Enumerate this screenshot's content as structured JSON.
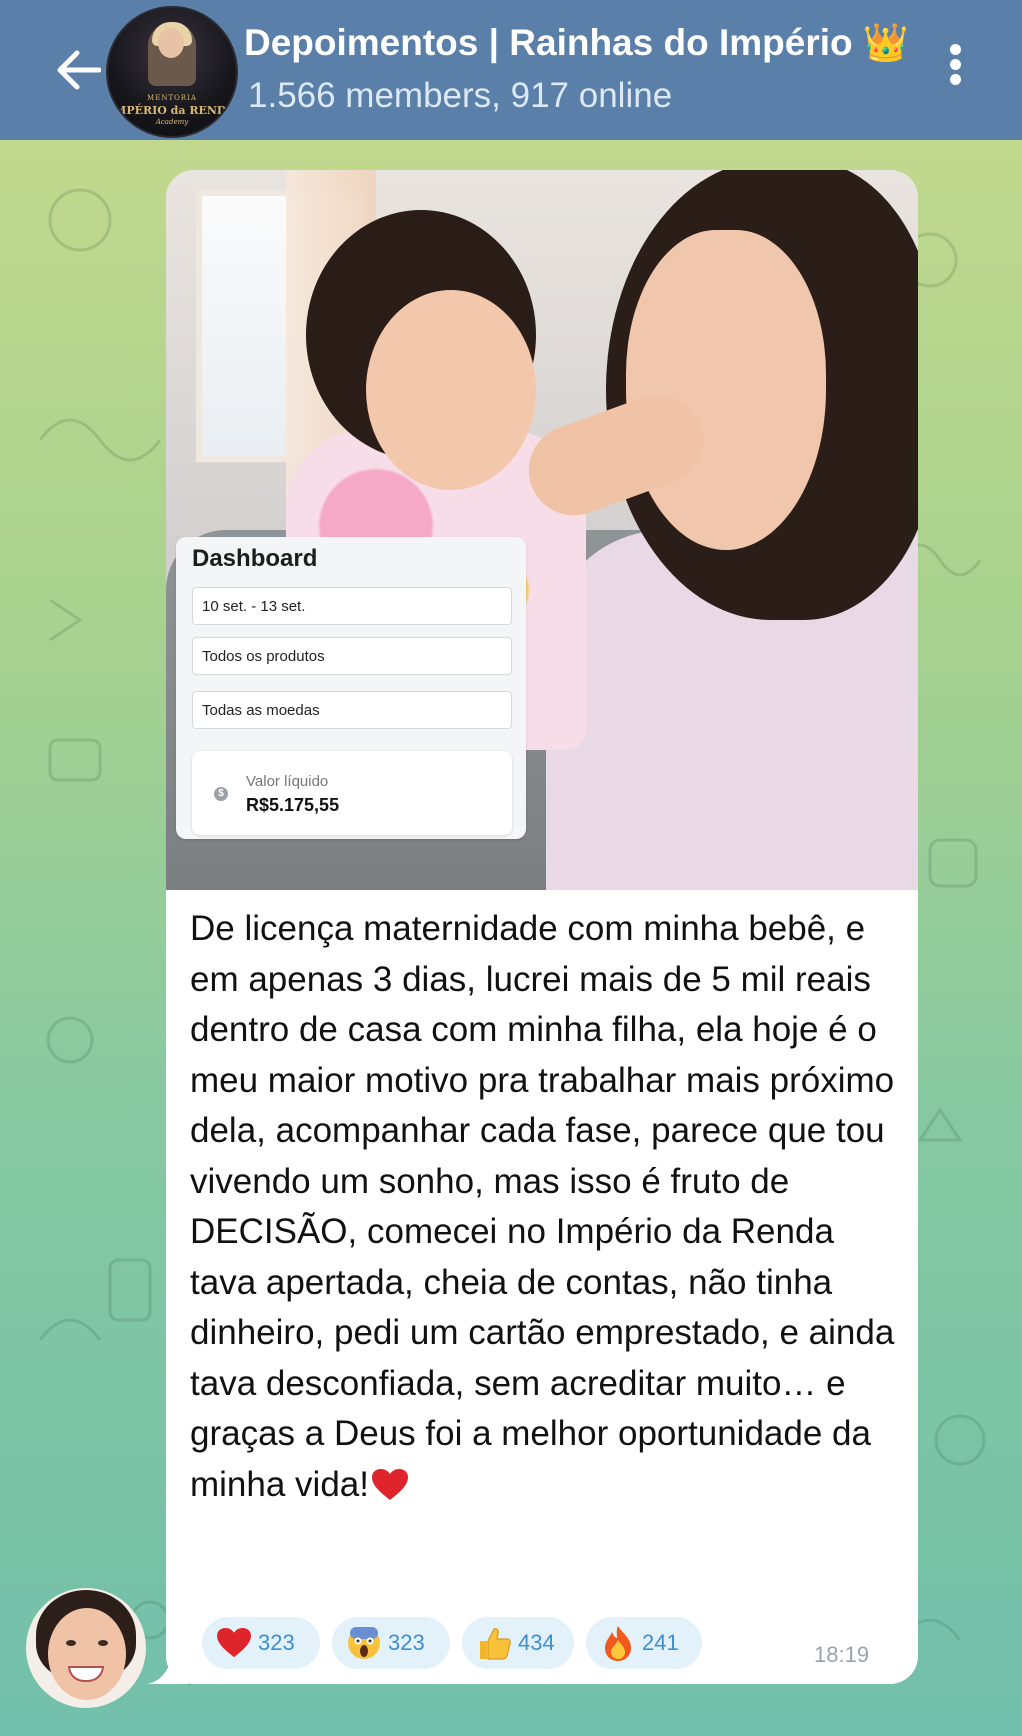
{
  "header": {
    "title": "Depoimentos | Rainhas do Império 👑",
    "subtitle": "1.566 members, 917 online",
    "avatar_text": [
      "MENTORIA",
      "IMPÉRIO da RENDA",
      "Academy"
    ]
  },
  "message": {
    "dashboard": {
      "title": "Dashboard",
      "date_range": "10 set. - 13 set.",
      "products": "Todos os produtos",
      "currencies": "Todas as moedas",
      "card_label": "Valor líquido",
      "card_value": "R$5.175,55"
    },
    "text": "De licença maternidade com minha bebê, e em apenas 3 dias, lucrei mais de 5 mil reais dentro de casa com minha filha, ela hoje é o meu maior motivo pra trabalhar mais próximo dela, acompanhar cada fase, parece que tou vivendo um sonho, mas isso é fruto de DECISÃO, comecei no Império da Renda tava apertada, cheia de contas, não tinha dinheiro, pedi um cartão emprestado, e ainda tava desconfiada, sem acreditar muito… e graças a Deus foi a melhor oportunidade da minha vida!",
    "reactions": [
      {
        "emoji": "heart-icon",
        "count": "323"
      },
      {
        "emoji": "scream-icon",
        "count": "323"
      },
      {
        "emoji": "thumbs-up-icon",
        "count": "434"
      },
      {
        "emoji": "fire-icon",
        "count": "241"
      }
    ],
    "time": "18:19"
  },
  "colors": {
    "header_bg": "#5a7fa8",
    "reaction_bg": "#e3f1fb",
    "reaction_count": "#3d8fd1"
  }
}
